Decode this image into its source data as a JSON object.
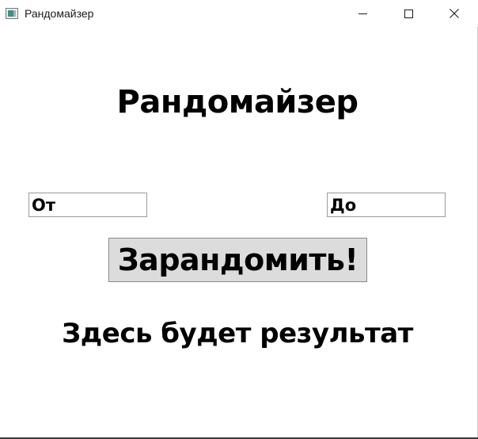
{
  "window": {
    "title": "Рандомайзер",
    "controls": {
      "minimize_icon": "minimize-icon",
      "maximize_icon": "maximize-icon",
      "close_icon": "close-icon",
      "close_glyph": "✕"
    }
  },
  "main": {
    "heading": "Рандомайзер",
    "from_field": {
      "value": "",
      "placeholder": "От"
    },
    "to_field": {
      "value": "",
      "placeholder": "До"
    },
    "randomize_button_label": "Зарандомить!",
    "result_text": "Здесь будет результат"
  },
  "colors": {
    "window_background": "#ffffff",
    "button_background": "#dcdcdc",
    "text": "#000000"
  }
}
